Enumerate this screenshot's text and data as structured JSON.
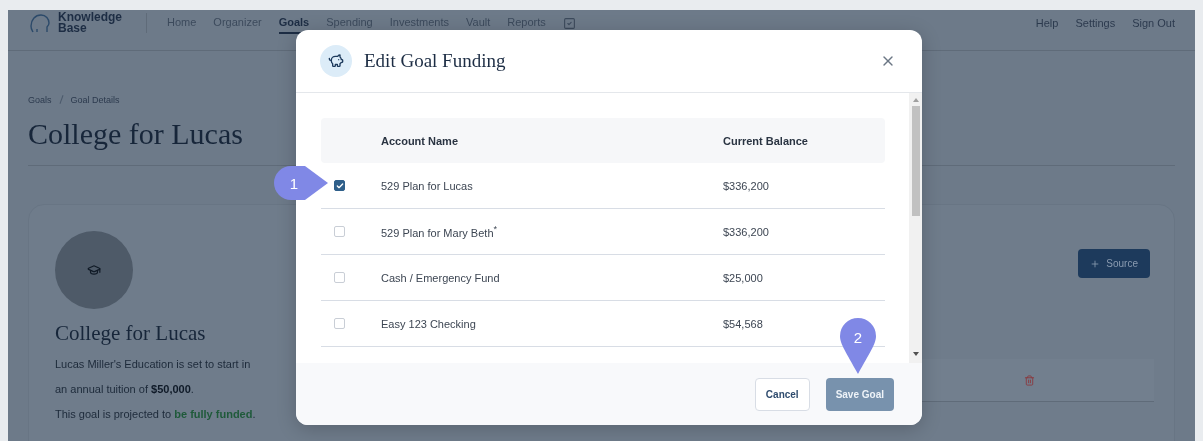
{
  "nav": {
    "logo": [
      "Knowledge",
      "Base"
    ],
    "items": [
      {
        "label": "Home",
        "selected": false
      },
      {
        "label": "Organizer",
        "selected": false
      },
      {
        "label": "Goals",
        "selected": true
      },
      {
        "label": "Spending",
        "selected": false
      },
      {
        "label": "Investments",
        "selected": false
      },
      {
        "label": "Vault",
        "selected": false
      },
      {
        "label": "Reports",
        "selected": false
      }
    ],
    "links": [
      "Help",
      "Settings",
      "Sign Out"
    ]
  },
  "breadcrumb": [
    "Goals",
    "Goal Details"
  ],
  "title": "College for Lucas",
  "goal_card": {
    "title": "College for Lucas",
    "source_button": "Source",
    "description": [
      [
        {
          "text": "Lucas Miller's Education is set to start in",
          "kind": "plain"
        }
      ],
      [
        {
          "text": "an annual tuition of ",
          "kind": "plain"
        },
        {
          "text": "$50,000",
          "kind": "strong"
        },
        {
          "text": ".",
          "kind": "plain"
        }
      ],
      [
        {
          "text": "This goal is projected to ",
          "kind": "plain"
        },
        {
          "text": "be fully funded",
          "kind": "positive"
        },
        {
          "text": ".",
          "kind": "plain"
        }
      ]
    ]
  },
  "modal": {
    "title": "Edit Goal Funding",
    "columns": [
      "Account Name",
      "Current Balance"
    ],
    "rows": [
      {
        "name": "529 Plan for Lucas",
        "balance": "$336,200",
        "checked": true
      },
      {
        "name": "529 Plan for Mary Beth$^{*}$",
        "balance": "$336,200",
        "checked": false
      },
      {
        "name": "Cash / Emergency Fund",
        "balance": "$25,000",
        "checked": false
      },
      {
        "name": "Easy 123 Checking",
        "balance": "$54,568",
        "checked": false
      }
    ],
    "buttons": {
      "cancel": "Cancel",
      "save": "Save Goal"
    }
  },
  "callouts": [
    "1",
    "2"
  ]
}
